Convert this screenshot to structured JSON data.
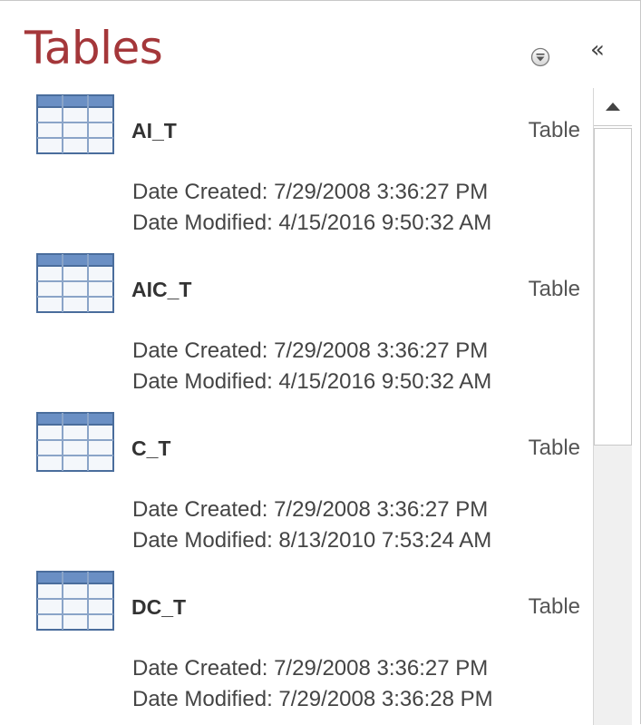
{
  "pane": {
    "title": "Tables",
    "menu_icon": "dropdown-circle-icon",
    "collapse_icon": "double-chevron-left-icon",
    "collapse_glyph": "«",
    "title_color": "#a4373a"
  },
  "items": [
    {
      "name": "AI_T",
      "type": "Table",
      "created": "Date Created: 7/29/2008 3:36:27 PM",
      "modified": "Date Modified: 4/15/2016 9:50:32 AM",
      "icon": "table-icon"
    },
    {
      "name": "AIC_T",
      "type": "Table",
      "created": "Date Created: 7/29/2008 3:36:27 PM",
      "modified": "Date Modified: 4/15/2016 9:50:32 AM",
      "icon": "table-icon"
    },
    {
      "name": "C_T",
      "type": "Table",
      "created": "Date Created: 7/29/2008 3:36:27 PM",
      "modified": "Date Modified: 8/13/2010 7:53:24 AM",
      "icon": "table-icon"
    },
    {
      "name": "DC_T",
      "type": "Table",
      "created": "Date Created: 7/29/2008 3:36:27 PM",
      "modified": "Date Modified: 7/29/2008 3:36:28 PM",
      "icon": "table-icon"
    }
  ]
}
